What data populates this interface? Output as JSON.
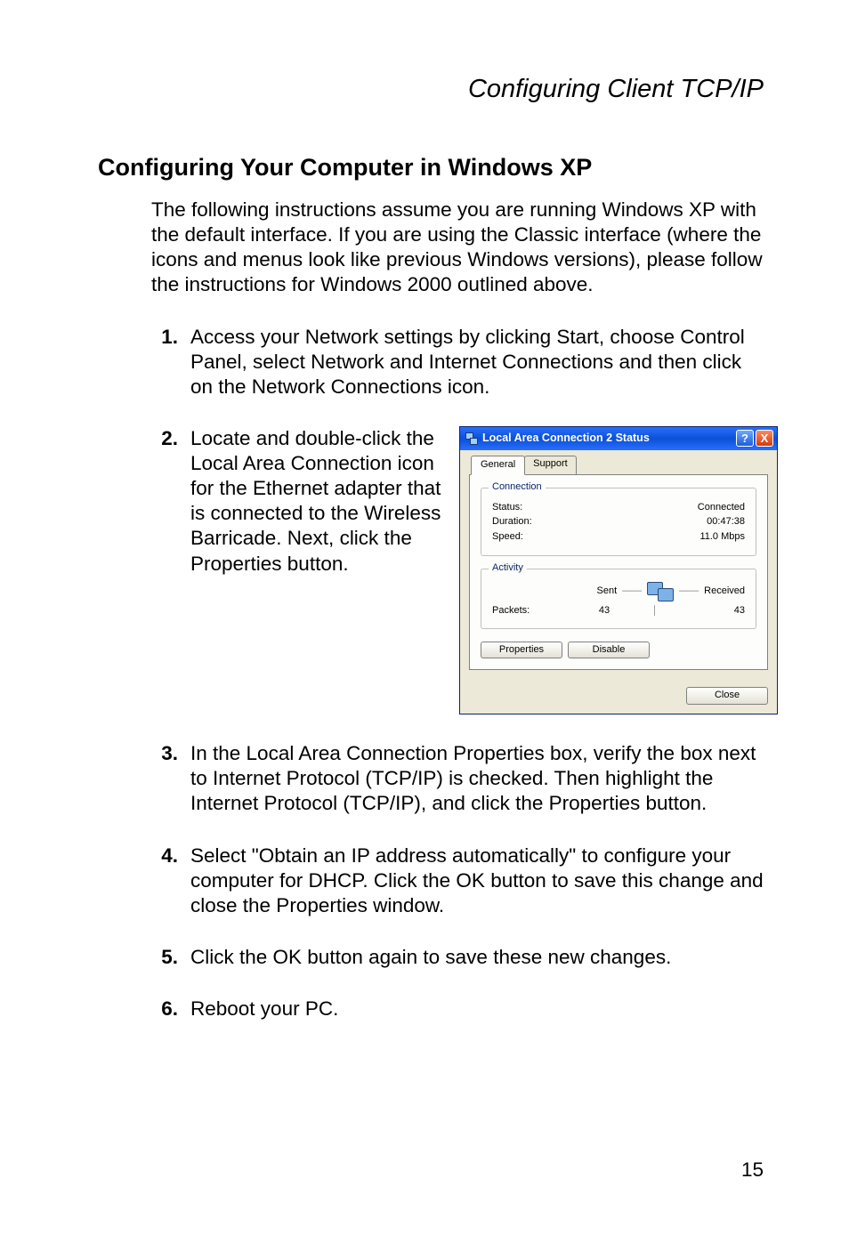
{
  "running_head": "Configuring Client TCP/IP",
  "section_title": "Configuring Your Computer in Windows XP",
  "intro": "The following instructions assume you are running Windows XP with the default interface. If you are using the Classic interface (where the icons and menus look like previous Windows versions), please follow the instructions for Windows 2000 outlined above.",
  "steps": {
    "s1_num": "1.",
    "s1": "Access your Network settings by clicking Start, choose Control Panel, select Network and Internet Connections and then click on the Network Connections icon.",
    "s2_num": "2.",
    "s2": "Locate and double-click the Local Area Connection icon for the Ethernet adapter that is connected to the Wireless Barricade. Next, click the Properties button.",
    "s3_num": "3.",
    "s3": "In the Local Area Connection Properties box, verify the box next to Internet Protocol (TCP/IP) is checked. Then highlight the Internet Protocol (TCP/IP), and click the Properties button.",
    "s4_num": "4.",
    "s4": "Select \"Obtain an IP address automatically\" to configure your computer for DHCP. Click the OK button to save this change and close the Properties window.",
    "s5_num": "5.",
    "s5": "Click the OK button again to save these new changes.",
    "s6_num": "6.",
    "s6": "Reboot your PC."
  },
  "dialog": {
    "title": "Local Area Connection 2 Status",
    "help": "?",
    "close_x": "X",
    "tab_general": "General",
    "tab_support": "Support",
    "grp_connection": "Connection",
    "lbl_status": "Status:",
    "val_status": "Connected",
    "lbl_duration": "Duration:",
    "val_duration": "00:47:38",
    "lbl_speed": "Speed:",
    "val_speed": "11.0 Mbps",
    "grp_activity": "Activity",
    "lbl_sent": "Sent",
    "lbl_received": "Received",
    "lbl_packets": "Packets:",
    "val_sent": "43",
    "val_recv": "43",
    "btn_properties": "Properties",
    "btn_disable": "Disable",
    "btn_close": "Close"
  },
  "page_number": "15"
}
